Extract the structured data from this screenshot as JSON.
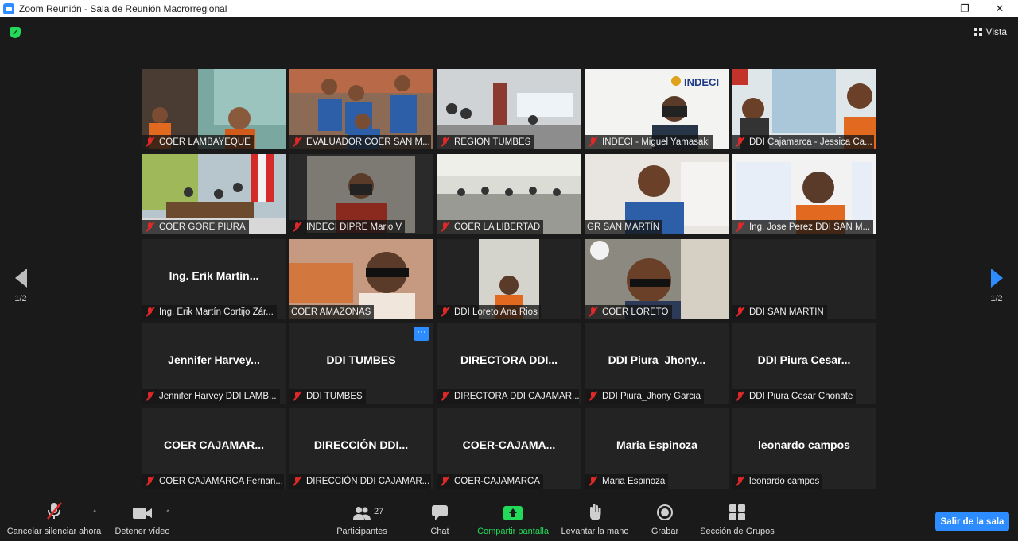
{
  "window": {
    "title": "Zoom Reunión - Sala de Reunión Macrorregional",
    "minimize": "—",
    "maximize": "❐",
    "close": "✕"
  },
  "header": {
    "view_label": "Vista"
  },
  "pager": {
    "left_page": "1/2",
    "right_page": "1/2"
  },
  "colors": {
    "accent": "#2d8cff",
    "share_green": "#23d959",
    "mute_red": "#e02828",
    "active_speaker": "#d6e04a",
    "tile_bg": "#232323"
  },
  "tiles": [
    {
      "label": "COER LAMBAYEQUE",
      "big": "",
      "muted": true
    },
    {
      "label": "EVALUADOR COER SAN M...",
      "big": "",
      "muted": true
    },
    {
      "label": "REGION TUMBES",
      "big": "",
      "muted": true
    },
    {
      "label": "INDECI - Miguel Yamasaki",
      "big": "",
      "muted": true
    },
    {
      "label": "DDI Cajamarca - Jessica Ca...",
      "big": "",
      "muted": true
    },
    {
      "label": "COER GORE PIURA",
      "big": "",
      "muted": true
    },
    {
      "label": "INDECI DIPRE Mario V",
      "big": "",
      "muted": true
    },
    {
      "label": "COER LA LIBERTAD",
      "big": "",
      "muted": true
    },
    {
      "label": "GR SAN MARTÍN",
      "big": "",
      "muted": false
    },
    {
      "label": "Ing. Jose Perez DDI SAN M...",
      "big": "",
      "muted": true
    },
    {
      "label": "Ing. Erik Martín Cortijo Zár...",
      "big": "Ing. Erik Martín...",
      "muted": true
    },
    {
      "label": "COER AMAZONAS",
      "big": "",
      "muted": false
    },
    {
      "label": "DDI Loreto Ana Rios",
      "big": "",
      "muted": true
    },
    {
      "label": "COER LORETO",
      "big": "",
      "muted": true
    },
    {
      "label": "DDI SAN MARTIN",
      "big": "",
      "muted": true
    },
    {
      "label": "Jennifer Harvey DDI LAMB...",
      "big": "Jennifer Harvey...",
      "muted": true
    },
    {
      "label": "DDI TUMBES",
      "big": "DDI TUMBES",
      "muted": true
    },
    {
      "label": "DIRECTORA DDI CAJAMAR...",
      "big": "DIRECTORA DDI...",
      "muted": true
    },
    {
      "label": "DDI Piura_Jhony Garcia",
      "big": "DDI Piura_Jhony...",
      "muted": true
    },
    {
      "label": "DDI Piura Cesar Chonate",
      "big": "DDI Piura Cesar...",
      "muted": true
    },
    {
      "label": "COER CAJAMARCA Fernan...",
      "big": "COER CAJAMAR...",
      "muted": true
    },
    {
      "label": "DIRECCIÓN DDI CAJAMAR...",
      "big": "DIRECCIÓN DDI...",
      "muted": true
    },
    {
      "label": "COER-CAJAMARCA",
      "big": "COER-CAJAMA...",
      "muted": true
    },
    {
      "label": "Maria Espinoza",
      "big": "Maria Espinoza",
      "muted": true
    },
    {
      "label": "leonardo campos",
      "big": "leonardo campos",
      "muted": true
    }
  ],
  "tile_more_button": "···",
  "toolbar": {
    "unmute": "Cancelar silenciar ahora",
    "stop_video": "Detener vídeo",
    "participants": "Participantes",
    "participants_count": "27",
    "chat": "Chat",
    "share_screen": "Compartir pantalla",
    "raise_hand": "Levantar la mano",
    "record": "Grabar",
    "breakout": "Sección de Grupos",
    "leave": "Salir de la sala",
    "caret": "^"
  }
}
